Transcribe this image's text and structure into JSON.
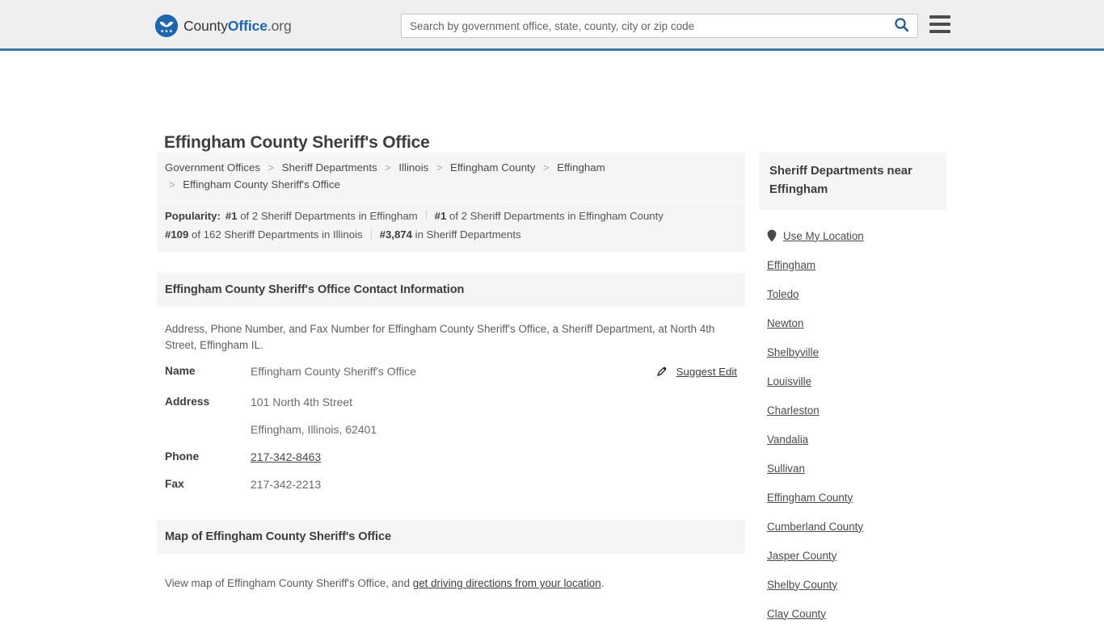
{
  "header": {
    "logo": {
      "icon": "eagle-shield-logo-icon",
      "text_part1": "County",
      "text_part2": "Office",
      "text_part3": ".org"
    },
    "search": {
      "placeholder": "Search by government office, state, county, city or zip code",
      "value": "",
      "search_icon": "search-icon"
    },
    "menu_icon": "hamburger-menu-icon",
    "accent_color": "#3f7ba8",
    "background_color": "#efefef"
  },
  "page": {
    "title": "Effingham County Sheriff's Office"
  },
  "breadcrumb": {
    "separator": ">",
    "items": [
      {
        "label": "Government Offices"
      },
      {
        "label": "Sheriff Departments"
      },
      {
        "label": "Illinois"
      },
      {
        "label": "Effingham County"
      },
      {
        "label": "Effingham"
      },
      {
        "label": "Effingham County Sheriff's Office"
      }
    ]
  },
  "popularity": {
    "label": "Popularity:",
    "items": [
      {
        "rank": "#1",
        "text": "of 2 Sheriff Departments in Effingham"
      },
      {
        "rank": "#1",
        "text": "of 2 Sheriff Departments in Effingham County"
      },
      {
        "rank": "#109",
        "text": "of 162 Sheriff Departments in Illinois"
      },
      {
        "rank": "#3,874",
        "text": "in Sheriff Departments"
      }
    ]
  },
  "contact_section": {
    "heading": "Effingham County Sheriff's Office Contact Information",
    "description": "Address, Phone Number, and Fax Number for Effingham County Sheriff's Office, a Sheriff Department, at North 4th Street, Effingham IL.",
    "suggest_edit": {
      "label": "Suggest Edit",
      "icon": "edit-pencil-icon"
    },
    "rows": [
      {
        "label": "Name",
        "value": "Effingham County Sheriff's Office",
        "link": false
      },
      {
        "label": "Address",
        "value": "101 North 4th Street",
        "value2": "Effingham, Illinois, 62401",
        "link": false
      },
      {
        "label": "Phone",
        "value": "217-342-8463",
        "link": true
      },
      {
        "label": "Fax",
        "value": "217-342-2213",
        "link": false
      }
    ]
  },
  "map_section": {
    "heading": "Map of Effingham County Sheriff's Office",
    "text_before": "View map of Effingham County Sheriff's Office, and ",
    "link_text": "get driving directions from your location",
    "text_after": "."
  },
  "sidebar": {
    "heading": "Sheriff Departments near Effingham",
    "use_my_location": {
      "label": "Use My Location",
      "icon": "map-pin-icon"
    },
    "items": [
      {
        "label": "Effingham"
      },
      {
        "label": "Toledo"
      },
      {
        "label": "Newton"
      },
      {
        "label": "Shelbyville"
      },
      {
        "label": "Louisville"
      },
      {
        "label": "Charleston"
      },
      {
        "label": "Vandalia"
      },
      {
        "label": "Sullivan"
      },
      {
        "label": "Effingham County"
      },
      {
        "label": "Cumberland County"
      },
      {
        "label": "Jasper County"
      },
      {
        "label": "Shelby County"
      },
      {
        "label": "Clay County"
      }
    ]
  }
}
